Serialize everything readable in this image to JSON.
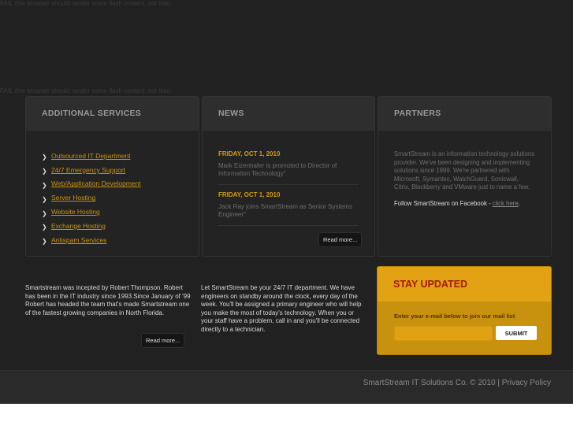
{
  "flash_fail": "FAIL (the browser should render some flash content, not this).",
  "services": {
    "title": "ADDITIONAL SERVICES",
    "items": [
      "Outsourced IT Department",
      "24/7 Emergency Support",
      "Web/Application Development",
      "Server Hosting",
      "Website Hosting",
      "Exchange Hosting",
      "Antispam Services"
    ]
  },
  "news": {
    "title": "NEWS",
    "items": [
      {
        "date": "FRIDAY, OCT 1, 2010",
        "text": "Mark Eizenhafer is promoted to Director of Information Technology\""
      },
      {
        "date": "FRIDAY, OCT 1, 2010",
        "text": "Jack Ray joins SmartStream as Senior Systems Engineer\""
      }
    ],
    "read_more": "Read more..."
  },
  "partners": {
    "title": "PARTNERS",
    "text": "SmartStream is an information technology solutions provider. We've been designing and implementing solutions since 1999. We're partnered with Microsoft, Symantec, WatchGuard, Sonicwall, Citrix, Blackberry and VMware just to name a few.",
    "follow": "Follow SmartStream on Facebook - ",
    "link": "click here",
    "after": "."
  },
  "about": {
    "text": "Smartstream was incepted by Robert Thompson. Robert has been in the IT industry since 1993.Since January of '99 Robert has headed the team that's made Smartstream one of the fastest growing companies in North Florida.",
    "read_more": "Read more..."
  },
  "support": {
    "text": "Let SmartStream be your 24/7 IT department. We have engineers on standby around the clock, every day of the week. You'll be assigned a primary engineer who will help you make the most of today's technology. When you or your staff have a problem, call in and you'll be connected directly to a technician."
  },
  "newsletter": {
    "title": "STAY UPDATED",
    "label": "Enter your e-mail below to join our mail list",
    "email": "",
    "submit": "SUBMIT"
  },
  "footer": {
    "copyright": "SmartStream IT Solutions Co. © 2010",
    "sep": " | ",
    "privacy": "Privacy Policy"
  }
}
